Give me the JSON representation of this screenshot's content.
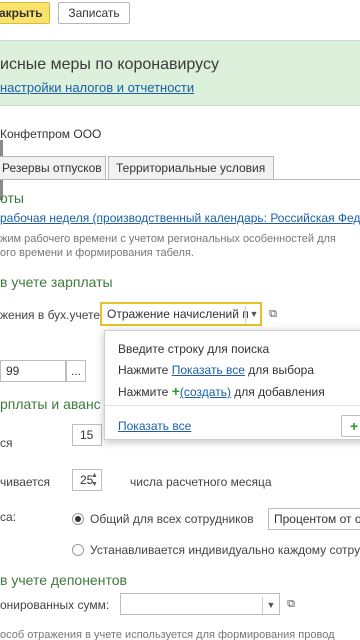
{
  "toolbar": {
    "primary_label": "акрыть",
    "secondary_label": "Записать"
  },
  "banner": {
    "title": "исные меры по коронавирусу",
    "link": "настройки налогов и отчетности"
  },
  "organization": "Конфетпром ООО",
  "tabs": [
    {
      "label": "Резервы отпусков"
    },
    {
      "label": "Территориальные условия"
    }
  ],
  "work_section": {
    "heading": "оты",
    "calendar_link": "рабочая неделя (производственный календарь: Российская Федер",
    "hint_line1": "жим рабочего времени с учетом региональных особенностей для",
    "hint_line2": "ого времени и формирования табеля."
  },
  "salary_accounting": {
    "heading": "в учете зарплаты",
    "reflection_label": "жения в бух.учете:",
    "reflection_value": "Отражение начислений п",
    "account_value": "99",
    "ellipsis": "..."
  },
  "popup": {
    "line1": "Введите строку для поиска",
    "line2_prefix": "Нажмите ",
    "line2_link": "Показать все",
    "line2_suffix": " для выбора",
    "line3_prefix": "Нажмите ",
    "line3_plus": "+",
    "line3_link": "(создать)",
    "line3_suffix": " для добавления",
    "show_all": "Показать все",
    "add_plus": "+"
  },
  "payments": {
    "heading": "рплаты и аванс",
    "row1_label": "ся",
    "row1_value": "15",
    "row2_label": "чивается",
    "row2_value": "25",
    "row2_suffix": "числа расчетного месяца",
    "advance_label": "са:",
    "radio1_label": "Общий для всех сотрудников",
    "radio1_select": "Процентом от о",
    "radio2_label": "Устанавливается индивидуально каждому сотру"
  },
  "deponents": {
    "heading": "в учете депонентов",
    "field_label": "онированных сумм:",
    "bottom_hint": "особ отражения в учете используется для формирования провод"
  }
}
